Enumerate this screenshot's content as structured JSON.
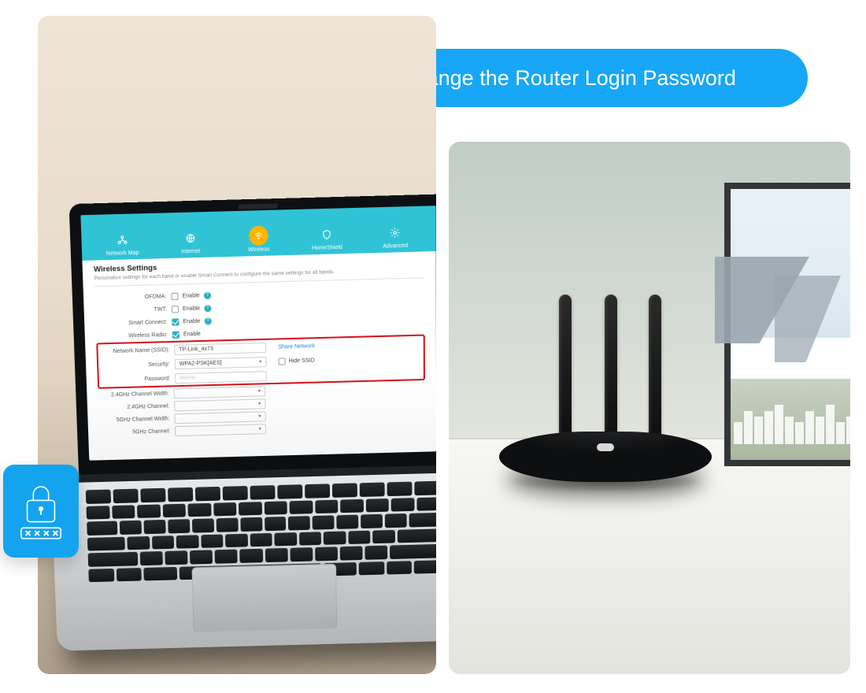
{
  "title_pill": "Change the Router Login Password",
  "nav": {
    "items": [
      {
        "label": "Network Map",
        "icon": "network-topology-icon"
      },
      {
        "label": "Internet",
        "icon": "globe-icon"
      },
      {
        "label": "Wireless",
        "icon": "wifi-icon",
        "active": true
      },
      {
        "label": "HomeShield",
        "icon": "shield-icon"
      },
      {
        "label": "Advanced",
        "icon": "gear-icon"
      }
    ]
  },
  "wireless": {
    "section_title": "Wireless Settings",
    "section_subtitle": "Personalize settings for each band or enable Smart Connect to configure the same settings for all bands.",
    "ofdma": {
      "label": "OFDMA:",
      "enable_label": "Enable",
      "enabled": false
    },
    "twt": {
      "label": "TWT:",
      "enable_label": "Enable",
      "enabled": false
    },
    "smart_connect": {
      "label": "Smart Connect:",
      "enable_label": "Enable",
      "enabled": true
    },
    "wireless_radio": {
      "label": "Wireless Radio:",
      "enable_label": "Enable",
      "enabled": true
    },
    "ssid": {
      "label": "Network Name (SSID):",
      "value": "TP-Link_4x73",
      "share_link": "Share Network",
      "hide_label": "Hide SSID",
      "hide_checked": false
    },
    "security": {
      "label": "Security:",
      "value": "WPA2-PSK[AES]"
    },
    "password": {
      "label": "Password:",
      "value_masked": "••••••"
    },
    "ch_width_24": {
      "label": "2.4GHz Channel Width:",
      "value": ""
    },
    "ch_24": {
      "label": "2.4GHz Channel:",
      "value": ""
    },
    "ch_width_5": {
      "label": "5GHz Channel Width:",
      "value": ""
    },
    "ch_5": {
      "label": "5GHz Channel:",
      "value": ""
    }
  },
  "colors": {
    "accent_cyan": "#30c3d6",
    "accent_orange": "#ffb400",
    "brand_blue": "#17a7f6",
    "highlight_red": "#d6111b"
  }
}
